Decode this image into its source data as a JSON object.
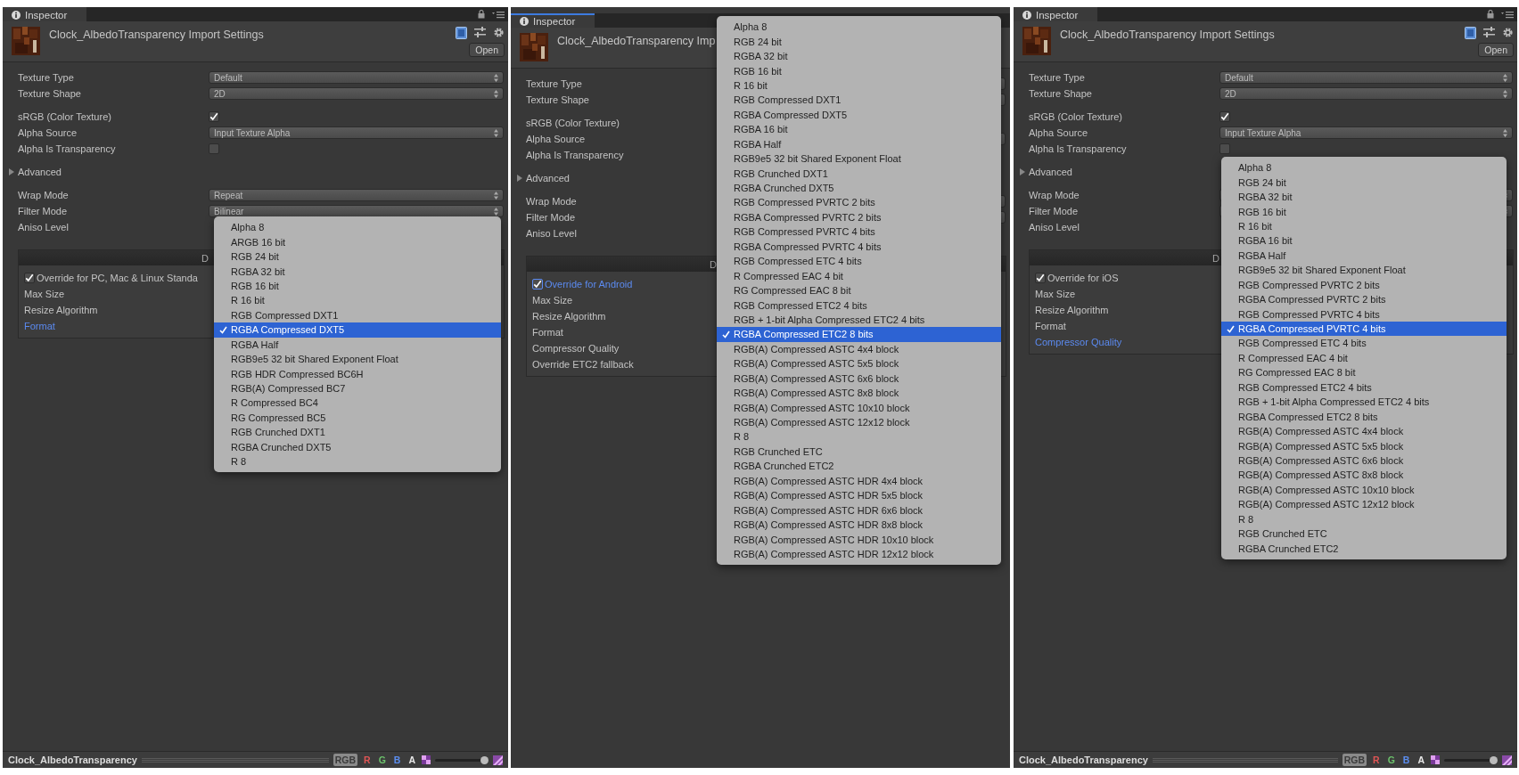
{
  "panels": [
    {
      "tab": {
        "label": "Inspector",
        "focused": false
      },
      "header": {
        "title": "Clock_AlbedoTransparency Import Settings",
        "open_button": "Open"
      },
      "sections": [
        {
          "rows": [
            {
              "label": "Texture Type",
              "kind": "popup",
              "value": "Default"
            },
            {
              "label": "Texture Shape",
              "kind": "popup",
              "value": "2D"
            }
          ]
        },
        {
          "rows": [
            {
              "label": "sRGB (Color Texture)",
              "kind": "checkbox",
              "checked": true
            },
            {
              "label": "Alpha Source",
              "kind": "popup",
              "value": "Input Texture Alpha"
            },
            {
              "label": "Alpha Is Transparency",
              "kind": "checkbox",
              "checked": false
            }
          ]
        },
        {
          "rows": [
            {
              "label": "Advanced",
              "kind": "foldout",
              "expanded": false
            }
          ]
        },
        {
          "rows": [
            {
              "label": "Wrap Mode",
              "kind": "popup",
              "value": "Repeat"
            },
            {
              "label": "Filter Mode",
              "kind": "popup",
              "value": "Bilinear"
            },
            {
              "label": "Aniso Level",
              "kind": "plain"
            }
          ]
        }
      ],
      "platform": {
        "tab_label": "D",
        "rows": [
          {
            "label": "Override for PC, Mac & Linux Standa",
            "kind": "checkbox",
            "checked": true,
            "focused": false
          },
          {
            "label": "Max Size",
            "kind": "plain",
            "focused": false
          },
          {
            "label": "Resize Algorithm",
            "kind": "plain",
            "focused": false
          },
          {
            "label": "Format",
            "kind": "plain",
            "focused": true
          }
        ]
      },
      "popup": {
        "items": [
          {
            "label": "Alpha 8",
            "selected": false
          },
          {
            "label": "ARGB 16 bit",
            "selected": false
          },
          {
            "label": "RGB 24 bit",
            "selected": false
          },
          {
            "label": "RGBA 32 bit",
            "selected": false
          },
          {
            "label": "RGB 16 bit",
            "selected": false
          },
          {
            "label": "R 16 bit",
            "selected": false
          },
          {
            "label": "RGB Compressed DXT1",
            "selected": false
          },
          {
            "label": "RGBA Compressed DXT5",
            "selected": true
          },
          {
            "label": "RGBA Half",
            "selected": false
          },
          {
            "label": "RGB9e5 32 bit Shared Exponent Float",
            "selected": false
          },
          {
            "label": "RGB HDR Compressed BC6H",
            "selected": false
          },
          {
            "label": "RGB(A) Compressed BC7",
            "selected": false
          },
          {
            "label": "R Compressed BC4",
            "selected": false
          },
          {
            "label": "RG Compressed BC5",
            "selected": false
          },
          {
            "label": "RGB Crunched DXT1",
            "selected": false
          },
          {
            "label": "RGBA Crunched DXT5",
            "selected": false
          },
          {
            "label": "R 8",
            "selected": false
          }
        ]
      },
      "status_bar": {
        "title": "Clock_AlbedoTransparency",
        "channels": [
          {
            "label": "RGB",
            "selected": true
          },
          {
            "label": "R",
            "selected": false,
            "color": "#e05555"
          },
          {
            "label": "G",
            "selected": false,
            "color": "#6cc36c"
          },
          {
            "label": "B",
            "selected": false,
            "color": "#5b8ef0"
          },
          {
            "label": "A",
            "selected": false,
            "color": "#e8e8e8"
          }
        ],
        "level": 0.93
      }
    },
    {
      "tab": {
        "label": "Inspector",
        "focused": true
      },
      "header": {
        "title": "Clock_AlbedoTransparency Imp"
      },
      "sections": [
        {
          "rows": [
            {
              "label": "Texture Type",
              "kind": "popup"
            },
            {
              "label": "Texture Shape",
              "kind": "popup"
            }
          ]
        },
        {
          "rows": [
            {
              "label": "sRGB (Color Texture)",
              "kind": "plain"
            },
            {
              "label": "Alpha Source",
              "kind": "popup"
            },
            {
              "label": "Alpha Is Transparency",
              "kind": "plain"
            }
          ]
        },
        {
          "rows": [
            {
              "label": "Advanced",
              "kind": "foldout",
              "expanded": false
            }
          ]
        },
        {
          "rows": [
            {
              "label": "Wrap Mode",
              "kind": "popup"
            },
            {
              "label": "Filter Mode",
              "kind": "popup"
            },
            {
              "label": "Aniso Level",
              "kind": "plain"
            }
          ]
        }
      ],
      "platform": {
        "tab_label": "D",
        "rows": [
          {
            "label": "Override for Android",
            "kind": "checkbox",
            "checked": true,
            "focused": true
          },
          {
            "label": "Max Size",
            "kind": "plain",
            "focused": false
          },
          {
            "label": "Resize Algorithm",
            "kind": "plain",
            "focused": false
          },
          {
            "label": "Format",
            "kind": "plain",
            "focused": false
          },
          {
            "label": "Compressor Quality",
            "kind": "plain",
            "focused": false
          },
          {
            "label": "Override ETC2 fallback",
            "kind": "plain",
            "focused": false
          }
        ]
      },
      "popup": {
        "items": [
          {
            "label": "Alpha 8",
            "selected": false
          },
          {
            "label": "RGB 24 bit",
            "selected": false
          },
          {
            "label": "RGBA 32 bit",
            "selected": false
          },
          {
            "label": "RGB 16 bit",
            "selected": false
          },
          {
            "label": "R 16 bit",
            "selected": false
          },
          {
            "label": "RGB Compressed DXT1",
            "selected": false
          },
          {
            "label": "RGBA Compressed DXT5",
            "selected": false
          },
          {
            "label": "RGBA 16 bit",
            "selected": false
          },
          {
            "label": "RGBA Half",
            "selected": false
          },
          {
            "label": "RGB9e5 32 bit Shared Exponent Float",
            "selected": false
          },
          {
            "label": "RGB Crunched DXT1",
            "selected": false
          },
          {
            "label": "RGBA Crunched DXT5",
            "selected": false
          },
          {
            "label": "RGB Compressed PVRTC 2 bits",
            "selected": false
          },
          {
            "label": "RGBA Compressed PVRTC 2 bits",
            "selected": false
          },
          {
            "label": "RGB Compressed PVRTC 4 bits",
            "selected": false
          },
          {
            "label": "RGBA Compressed PVRTC 4 bits",
            "selected": false
          },
          {
            "label": "RGB Compressed ETC 4 bits",
            "selected": false
          },
          {
            "label": "R Compressed EAC 4 bit",
            "selected": false
          },
          {
            "label": "RG Compressed EAC 8 bit",
            "selected": false
          },
          {
            "label": "RGB Compressed ETC2 4 bits",
            "selected": false
          },
          {
            "label": "RGB + 1-bit Alpha Compressed ETC2 4 bits",
            "selected": false
          },
          {
            "label": "RGBA Compressed ETC2 8 bits",
            "selected": true
          },
          {
            "label": "RGB(A) Compressed ASTC 4x4 block",
            "selected": false
          },
          {
            "label": "RGB(A) Compressed ASTC 5x5 block",
            "selected": false
          },
          {
            "label": "RGB(A) Compressed ASTC 6x6 block",
            "selected": false
          },
          {
            "label": "RGB(A) Compressed ASTC 8x8 block",
            "selected": false
          },
          {
            "label": "RGB(A) Compressed ASTC 10x10 block",
            "selected": false
          },
          {
            "label": "RGB(A) Compressed ASTC 12x12 block",
            "selected": false
          },
          {
            "label": "R 8",
            "selected": false
          },
          {
            "label": "RGB Crunched ETC",
            "selected": false
          },
          {
            "label": "RGBA Crunched ETC2",
            "selected": false
          },
          {
            "label": "RGB(A) Compressed ASTC HDR 4x4 block",
            "selected": false
          },
          {
            "label": "RGB(A) Compressed ASTC HDR 5x5 block",
            "selected": false
          },
          {
            "label": "RGB(A) Compressed ASTC HDR 6x6 block",
            "selected": false
          },
          {
            "label": "RGB(A) Compressed ASTC HDR 8x8 block",
            "selected": false
          },
          {
            "label": "RGB(A) Compressed ASTC HDR 10x10 block",
            "selected": false
          },
          {
            "label": "RGB(A) Compressed ASTC HDR 12x12 block",
            "selected": false
          }
        ]
      }
    },
    {
      "tab": {
        "label": "Inspector",
        "focused": false
      },
      "header": {
        "title": "Clock_AlbedoTransparency Import Settings",
        "open_button": "Open"
      },
      "sections": [
        {
          "rows": [
            {
              "label": "Texture Type",
              "kind": "popup",
              "value": "Default"
            },
            {
              "label": "Texture Shape",
              "kind": "popup",
              "value": "2D"
            }
          ]
        },
        {
          "rows": [
            {
              "label": "sRGB (Color Texture)",
              "kind": "checkbox",
              "checked": true
            },
            {
              "label": "Alpha Source",
              "kind": "popup",
              "value": "Input Texture Alpha"
            },
            {
              "label": "Alpha Is Transparency",
              "kind": "checkbox",
              "checked": false
            }
          ]
        },
        {
          "rows": [
            {
              "label": "Advanced",
              "kind": "foldout",
              "expanded": false
            }
          ]
        },
        {
          "rows": [
            {
              "label": "Wrap Mode",
              "kind": "popup"
            },
            {
              "label": "Filter Mode",
              "kind": "popup"
            },
            {
              "label": "Aniso Level",
              "kind": "plain"
            }
          ]
        }
      ],
      "platform": {
        "tab_label": "D",
        "rows": [
          {
            "label": "Override for iOS",
            "kind": "checkbox",
            "checked": true,
            "focused": false
          },
          {
            "label": "Max Size",
            "kind": "plain",
            "focused": false
          },
          {
            "label": "Resize Algorithm",
            "kind": "plain",
            "focused": false
          },
          {
            "label": "Format",
            "kind": "plain",
            "focused": false
          },
          {
            "label": "Compressor Quality",
            "kind": "plain",
            "focused": true
          }
        ]
      },
      "popup": {
        "items": [
          {
            "label": "Alpha 8",
            "selected": false
          },
          {
            "label": "RGB 24 bit",
            "selected": false
          },
          {
            "label": "RGBA 32 bit",
            "selected": false
          },
          {
            "label": "RGB 16 bit",
            "selected": false
          },
          {
            "label": "R 16 bit",
            "selected": false
          },
          {
            "label": "RGBA 16 bit",
            "selected": false
          },
          {
            "label": "RGBA Half",
            "selected": false
          },
          {
            "label": "RGB9e5 32 bit Shared Exponent Float",
            "selected": false
          },
          {
            "label": "RGB Compressed PVRTC 2 bits",
            "selected": false
          },
          {
            "label": "RGBA Compressed PVRTC 2 bits",
            "selected": false
          },
          {
            "label": "RGB Compressed PVRTC 4 bits",
            "selected": false
          },
          {
            "label": "RGBA Compressed PVRTC 4 bits",
            "selected": true
          },
          {
            "label": "RGB Compressed ETC 4 bits",
            "selected": false
          },
          {
            "label": "R Compressed EAC 4 bit",
            "selected": false
          },
          {
            "label": "RG Compressed EAC 8 bit",
            "selected": false
          },
          {
            "label": "RGB Compressed ETC2 4 bits",
            "selected": false
          },
          {
            "label": "RGB + 1-bit Alpha Compressed ETC2 4 bits",
            "selected": false
          },
          {
            "label": "RGBA Compressed ETC2 8 bits",
            "selected": false
          },
          {
            "label": "RGB(A) Compressed ASTC 4x4 block",
            "selected": false
          },
          {
            "label": "RGB(A) Compressed ASTC 5x5 block",
            "selected": false
          },
          {
            "label": "RGB(A) Compressed ASTC 6x6 block",
            "selected": false
          },
          {
            "label": "RGB(A) Compressed ASTC 8x8 block",
            "selected": false
          },
          {
            "label": "RGB(A) Compressed ASTC 10x10 block",
            "selected": false
          },
          {
            "label": "RGB(A) Compressed ASTC 12x12 block",
            "selected": false
          },
          {
            "label": "R 8",
            "selected": false
          },
          {
            "label": "RGB Crunched ETC",
            "selected": false
          },
          {
            "label": "RGBA Crunched ETC2",
            "selected": false
          }
        ]
      },
      "status_bar": {
        "title": "Clock_AlbedoTransparency",
        "channels": [
          {
            "label": "RGB",
            "selected": true
          },
          {
            "label": "R",
            "selected": false,
            "color": "#e05555"
          },
          {
            "label": "G",
            "selected": false,
            "color": "#6cc36c"
          },
          {
            "label": "B",
            "selected": false,
            "color": "#5b8ef0"
          },
          {
            "label": "A",
            "selected": false,
            "color": "#e8e8e8"
          }
        ],
        "level": 0.93
      }
    }
  ]
}
